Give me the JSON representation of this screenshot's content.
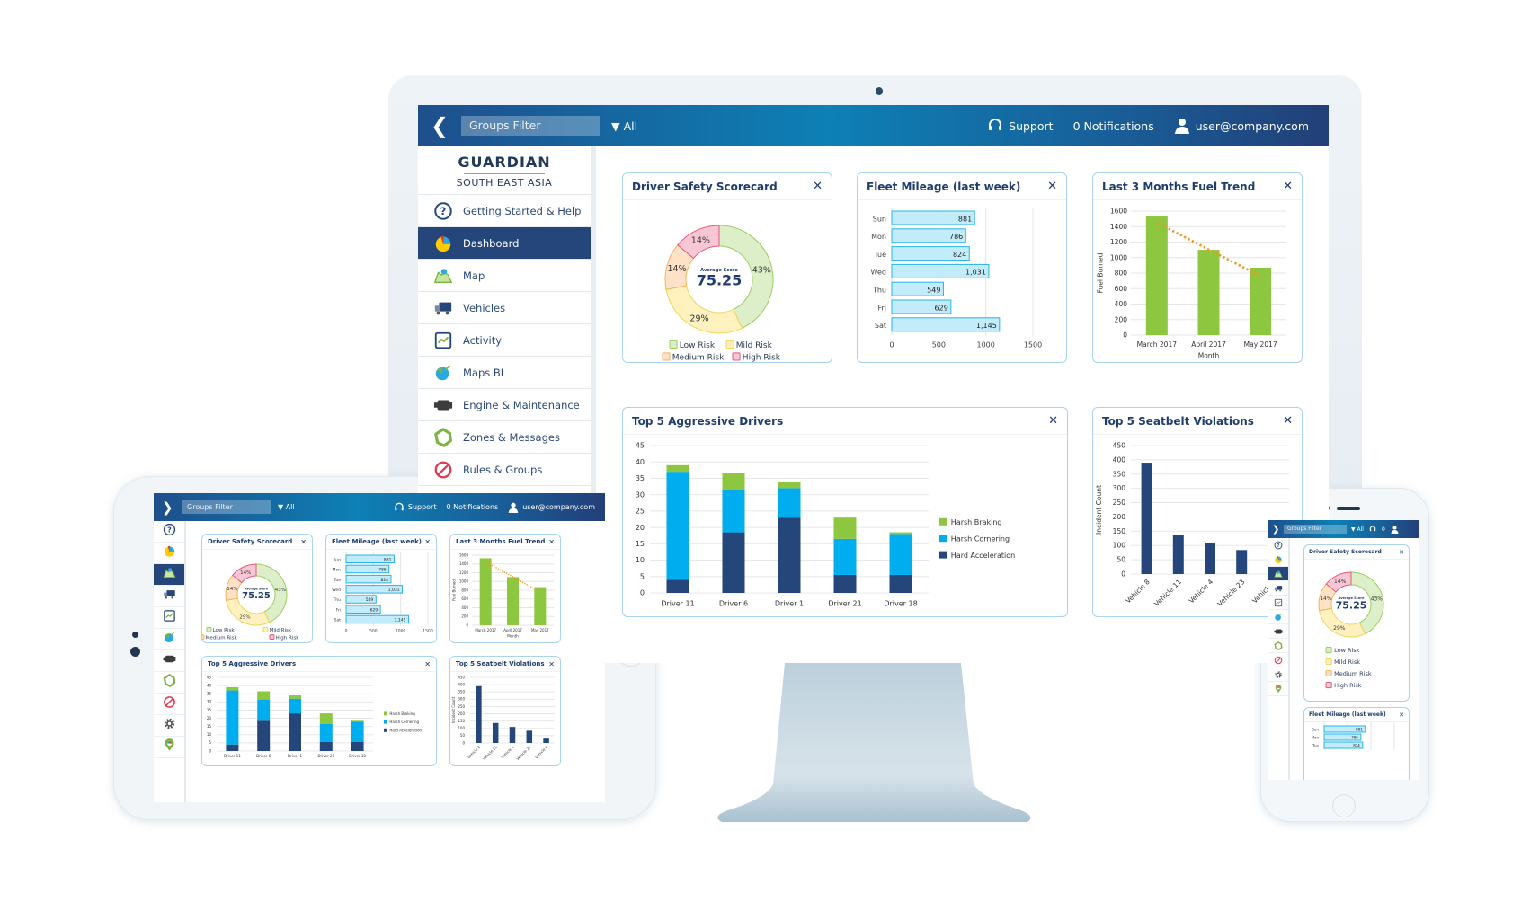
{
  "header": {
    "back_icon": "chevron-left-icon",
    "groups_filter_placeholder": "Groups Filter",
    "filter_value": "All",
    "support_label": "Support",
    "notifications_label": "0 Notifications",
    "notifications_count": "0",
    "user_label": "user@company.com"
  },
  "brand": {
    "name": "GUARDIAN",
    "region": "SOUTH EAST ASIA"
  },
  "sidebar": {
    "items": [
      {
        "label": "Getting Started & Help",
        "icon": "help-circle-icon"
      },
      {
        "label": "Dashboard",
        "icon": "pie-chart-icon",
        "active": true
      },
      {
        "label": "Map",
        "icon": "map-icon"
      },
      {
        "label": "Vehicles",
        "icon": "truck-icon"
      },
      {
        "label": "Activity",
        "icon": "activity-icon"
      },
      {
        "label": "Maps BI",
        "icon": "globe-icon"
      },
      {
        "label": "Engine & Maintenance",
        "icon": "engine-icon"
      },
      {
        "label": "Zones & Messages",
        "icon": "zone-icon"
      },
      {
        "label": "Rules & Groups",
        "icon": "no-entry-icon"
      }
    ],
    "extra_icons": [
      "gear-icon",
      "map-pin-icon"
    ]
  },
  "cards": {
    "scorecard": {
      "title": "Driver Safety Scorecard",
      "close": "✕",
      "center_label": "Average Score",
      "center_value": "75.25"
    },
    "mileage": {
      "title": "Fleet Mileage (last week)",
      "close": "✕"
    },
    "fuel": {
      "title": "Last 3 Months Fuel Trend",
      "close": "✕"
    },
    "drivers": {
      "title": "Top 5 Aggressive Drivers",
      "close": "✕"
    },
    "seatbelt": {
      "title": "Top 5 Seatbelt Violations",
      "close": "✕"
    }
  },
  "colors": {
    "brand_navy": "#24467b",
    "low_risk": "#dcefc8",
    "low_risk_edge": "#9ccc65",
    "mild_risk": "#fff2bf",
    "mild_risk_edge": "#f3d35b",
    "medium_risk": "#fde2c7",
    "medium_risk_edge": "#f6b35a",
    "high_risk": "#f8c7d5",
    "high_risk_edge": "#e8577d",
    "mileage_bar": "#c3ecfa",
    "mileage_edge": "#29b3e8",
    "fuel_bar": "#8dc63f",
    "trend": "#f7941d",
    "harsh_braking": "#8dc63f",
    "harsh_cornering": "#00aeef",
    "hard_acceleration": "#24467b",
    "seatbelt_bar": "#24467b"
  },
  "chart_data": [
    {
      "id": "scorecard",
      "type": "pie",
      "title": "Driver Safety Scorecard",
      "categories": [
        "Low Risk",
        "Mild Risk",
        "Medium Risk",
        "High Risk"
      ],
      "values": [
        43,
        29,
        14,
        14
      ],
      "labels": [
        "43%",
        "29%",
        "14%",
        "14%"
      ],
      "center_text": "Average Score 75.25",
      "legend": "bottom"
    },
    {
      "id": "mileage",
      "type": "bar",
      "orientation": "horizontal",
      "title": "Fleet Mileage (last week)",
      "categories": [
        "Sun",
        "Mon",
        "Tue",
        "Wed",
        "Thu",
        "Fri",
        "Sat"
      ],
      "values": [
        881,
        786,
        824,
        1031,
        549,
        629,
        1145
      ],
      "value_labels": [
        "881",
        "786",
        "824",
        "1,031",
        "549",
        "629",
        "1,145"
      ],
      "xlim": [
        0,
        1500
      ],
      "xticks": [
        "0",
        "500",
        "1000",
        "1500"
      ],
      "grid": true
    },
    {
      "id": "fuel",
      "type": "bar",
      "title": "Last 3 Months Fuel Trend",
      "categories": [
        "March 2017",
        "April 2017",
        "May 2017"
      ],
      "values": [
        1530,
        1100,
        870
      ],
      "trendline": {
        "start": 1450,
        "end": 760,
        "style": "dotted"
      },
      "xlabel": "Month",
      "ylabel": "Fuel Burned",
      "ylim": [
        0,
        1600
      ],
      "yticks": [
        "0",
        "200",
        "400",
        "600",
        "800",
        "1000",
        "1200",
        "1400",
        "1600"
      ],
      "grid": true
    },
    {
      "id": "drivers",
      "type": "bar",
      "stacked": true,
      "title": "Top 5 Aggressive Drivers",
      "categories": [
        "Driver 11",
        "Driver 6",
        "Driver 1",
        "Driver 21",
        "Driver 18"
      ],
      "series": [
        {
          "name": "Hard Acceleration",
          "values": [
            4,
            18.5,
            23,
            5.5,
            5.5
          ]
        },
        {
          "name": "Harsh Cornering",
          "values": [
            33,
            13,
            9,
            11,
            12.5
          ]
        },
        {
          "name": "Harsh Braking",
          "values": [
            2,
            5,
            2,
            6.5,
            0.5
          ]
        }
      ],
      "legend_order": [
        "Harsh Braking",
        "Harsh Cornering",
        "Hard Acceleration"
      ],
      "ylim": [
        0,
        45
      ],
      "yticks": [
        "0",
        "5",
        "10",
        "15",
        "20",
        "25",
        "30",
        "35",
        "40",
        "45"
      ],
      "legend": "right",
      "grid": true
    },
    {
      "id": "seatbelt",
      "type": "bar",
      "title": "Top 5 Seatbelt Violations",
      "categories": [
        "Vehicle 8",
        "Vehicle 11",
        "Vehicle 4",
        "Vehicle 23",
        "Vehicle 6"
      ],
      "values": [
        390,
        137,
        110,
        84,
        30
      ],
      "ylabel": "Incident Count",
      "ylim": [
        0,
        450
      ],
      "yticks": [
        "0",
        "50",
        "100",
        "150",
        "200",
        "250",
        "300",
        "350",
        "400",
        "450"
      ],
      "grid": true
    }
  ]
}
